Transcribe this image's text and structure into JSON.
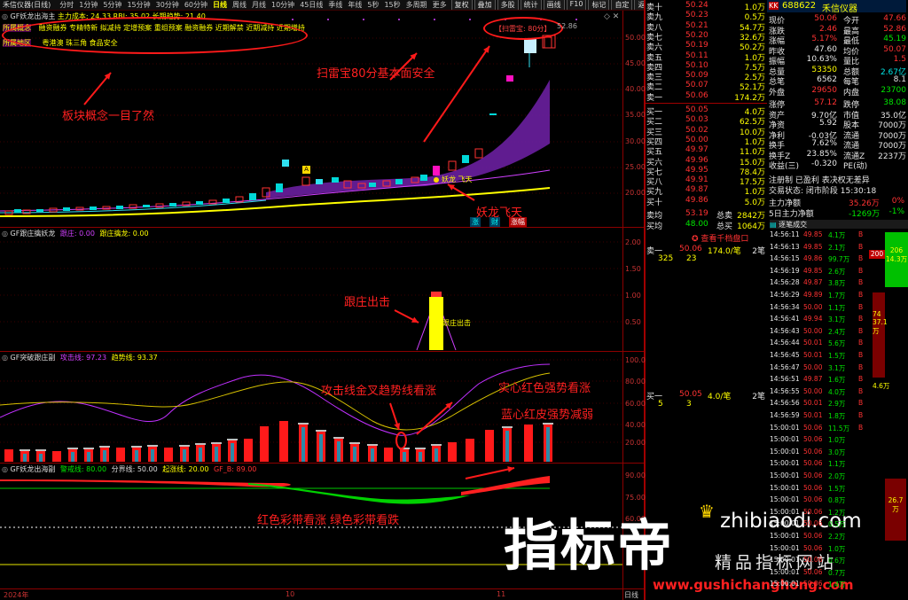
{
  "toolbar": {
    "app_title": "禾信仪器(日线)",
    "timeframes": [
      "分时",
      "1分钟",
      "5分钟",
      "15分钟",
      "30分钟",
      "60分钟",
      "日线",
      "周线",
      "月线",
      "10分钟",
      "45日线",
      "季线",
      "年线",
      "5秒",
      "15秒",
      "多周期",
      "更多"
    ],
    "active_timeframe": "日线",
    "buttons": [
      "复权",
      "叠加",
      "多股",
      "统计",
      "画线",
      "F10",
      "标记",
      "自定",
      "返回"
    ]
  },
  "main_panel": {
    "title_name": "GF妖龙出海主",
    "indicator_text": "主力成本: 24.33 RBI: 35.02 长期趋势: 21.40",
    "concept_label": "所属概念",
    "concepts": "融资融券 专精特新 拟减持 定增预案 重组预案 融资融券 近期解禁 近期减持 近期增持",
    "region_label": "所属地区",
    "region": "粤港澳 珠三角 食品安全",
    "saolei_text": "【扫雷宝: 80分】",
    "high_label": "52.86",
    "badge_a": "A",
    "yaolong_small": "妖龙 飞天",
    "bottom_tags": [
      "涨",
      "财",
      "涨幅"
    ],
    "y_ticks": [
      "50.00",
      "45.00",
      "40.00",
      "35.00",
      "30.00",
      "25.00",
      "20.00"
    ]
  },
  "sub1": {
    "title": "GF跟庄擒妖龙",
    "l1": "跟庄: 0.00",
    "l2": "跟庄擒龙: 0.00",
    "bar_label": "跟庄出击",
    "y_ticks": [
      "2.00",
      "1.50",
      "1.00",
      "0.50"
    ]
  },
  "sub2": {
    "title": "GF突破跟庄副",
    "l1": "攻击线: 97.23",
    "l2": "趋势线: 93.37",
    "y_ticks": [
      "100.0",
      "80.00",
      "60.00",
      "40.00",
      "20.00"
    ]
  },
  "sub3": {
    "title": "GF妖龙出海副",
    "l1": "警戒线: 80.00",
    "l2": "分界线: 50.00",
    "l3": "起涨线: 20.00",
    "l4": "GF_B: 89.00",
    "y_ticks": [
      "90.00",
      "75.00",
      "60.00"
    ]
  },
  "xaxis": {
    "labels": [
      "2024年",
      "10",
      "11"
    ],
    "right": "日线"
  },
  "annotations": {
    "a1": "板块概念一目了然",
    "a2": "扫雷宝80分基本面安全",
    "a3": "妖龙飞天",
    "a4": "跟庄出击",
    "a5": "攻击线金叉趋势线看涨",
    "a6": "实心红色强势看涨",
    "a7": "蓝心红皮强势减弱",
    "a8": "红色彩带看涨 绿色彩带看跌"
  },
  "watermark": {
    "main": "指标帝",
    "domain": "zhibiaodi.com",
    "line2": "精品指标网站",
    "url": "www.gushichanghong.com"
  },
  "stock": {
    "code": "688622",
    "name": "禾信仪器",
    "prefix": "KK"
  },
  "orderbook": {
    "asks": [
      {
        "label": "卖十",
        "price": "50.24",
        "vol": "1.0万"
      },
      {
        "label": "卖九",
        "price": "50.23",
        "vol": "0.5万"
      },
      {
        "label": "卖八",
        "price": "50.21",
        "vol": "54.7万"
      },
      {
        "label": "卖七",
        "price": "50.20",
        "vol": "32.6万"
      },
      {
        "label": "卖六",
        "price": "50.19",
        "vol": "50.2万"
      },
      {
        "label": "卖五",
        "price": "50.11",
        "vol": "1.0万"
      },
      {
        "label": "卖四",
        "price": "50.10",
        "vol": "7.5万"
      },
      {
        "label": "卖三",
        "price": "50.09",
        "vol": "2.5万"
      },
      {
        "label": "卖二",
        "price": "50.07",
        "vol": "52.1万"
      },
      {
        "label": "卖一",
        "price": "50.06",
        "vol": "174.2万"
      }
    ],
    "bids": [
      {
        "label": "买一",
        "price": "50.05",
        "vol": "4.0万"
      },
      {
        "label": "买二",
        "price": "50.03",
        "vol": "62.5万"
      },
      {
        "label": "买三",
        "price": "50.02",
        "vol": "10.0万"
      },
      {
        "label": "买四",
        "price": "50.00",
        "vol": "1.0万"
      },
      {
        "label": "买五",
        "price": "49.97",
        "vol": "11.0万"
      },
      {
        "label": "买六",
        "price": "49.96",
        "vol": "15.0万"
      },
      {
        "label": "买七",
        "price": "49.95",
        "vol": "78.4万"
      },
      {
        "label": "买八",
        "price": "49.91",
        "vol": "17.5万"
      },
      {
        "label": "买九",
        "price": "49.87",
        "vol": "1.0万"
      },
      {
        "label": "买十",
        "price": "49.86",
        "vol": "5.0万"
      }
    ],
    "avg_sell": {
      "label": "卖均",
      "price": "53.19",
      "tl": "总卖",
      "tv": "2842万"
    },
    "avg_buy": {
      "label": "买均",
      "price": "48.00",
      "tl": "总买",
      "tv": "1064万"
    },
    "l2_link": "查看千档盘口",
    "sell1_row": {
      "label": "卖一",
      "price": "50.06",
      "vol": "174.0/笔",
      "cnt": "2笔",
      "d1": "325",
      "d2": "23"
    },
    "buy1_row": {
      "label": "买一",
      "price": "50.05",
      "vol": "4.0/笔",
      "cnt": "2笔",
      "d1": "5",
      "d2": "3"
    }
  },
  "stats": [
    {
      "l": "现价",
      "v": "50.06",
      "l2": "今开",
      "v2": "47.66",
      "c1": "red",
      "c2": "red"
    },
    {
      "l": "涨跌",
      "v": "2.46",
      "l2": "最高",
      "v2": "52.86",
      "c1": "red",
      "c2": "red"
    },
    {
      "l": "涨幅",
      "v": "5.17%",
      "l2": "最低",
      "v2": "45.19",
      "c1": "red",
      "c2": "green"
    },
    {
      "l": "昨收",
      "v": "47.60",
      "l2": "均价",
      "v2": "50.07",
      "c1": "wht",
      "c2": "red"
    },
    {
      "l": "振幅",
      "v": "10.63%",
      "l2": "量比",
      "v2": "1.5",
      "c1": "wht",
      "c2": "red"
    },
    {
      "l": "总量",
      "v": "53350",
      "l2": "总额",
      "v2": "2.67亿",
      "c1": "yel",
      "c2": "cyan"
    },
    {
      "l": "总笔",
      "v": "6562",
      "l2": "每笔",
      "v2": "8.1",
      "c1": "wht",
      "c2": "wht"
    },
    {
      "l": "外盘",
      "v": "29650",
      "l2": "内盘",
      "v2": "23700",
      "c1": "red",
      "c2": "green"
    },
    {
      "l": "涨停",
      "v": "57.12",
      "l2": "跌停",
      "v2": "38.08",
      "c1": "red",
      "c2": "green"
    },
    {
      "l": "资产",
      "v": "9.70亿",
      "l2": "市值",
      "v2": "35.0亿",
      "c1": "wht",
      "c2": "wht"
    },
    {
      "l": "净资",
      "v": "5.92",
      "l2": "股本",
      "v2": "7000万",
      "c1": "wht",
      "c2": "wht"
    },
    {
      "l": "净利",
      "v": "-0.03亿",
      "l2": "流通",
      "v2": "7000万",
      "c1": "wht",
      "c2": "wht"
    },
    {
      "l": "换手",
      "v": "7.62%",
      "l2": "流通",
      "v2": "7000万",
      "c1": "wht",
      "c2": "wht"
    },
    {
      "l": "换手Z",
      "v": "23.85%",
      "l2": "流通Z",
      "v2": "2237万",
      "c1": "wht",
      "c2": "wht"
    },
    {
      "l": "收益(三)",
      "v": "-0.320",
      "l2": "PE(动)",
      "v2": "",
      "c1": "wht",
      "c2": "wht"
    }
  ],
  "info": {
    "line1": "注册制 已盈利 表决权无差异",
    "line2_label": "交易状态:",
    "line2_val": "闭市阶段 15:30:18"
  },
  "netflow": [
    {
      "l": "主力净额",
      "v": "35.26万",
      "p": "0%",
      "c": "red"
    },
    {
      "l": "5日主力净额",
      "v": "-1269万",
      "p": "-1%",
      "c": "green"
    }
  ],
  "trades_title": "逐笔成交",
  "trades": [
    [
      "14:56:11",
      "49.85",
      "4.1万",
      "B"
    ],
    [
      "14:56:13",
      "49.85",
      "2.1万",
      "B"
    ],
    [
      "14:56:15",
      "49.86",
      "99.7万",
      "B"
    ],
    [
      "14:56:19",
      "49.85",
      "2.6万",
      "B"
    ],
    [
      "14:56:28",
      "49.87",
      "3.8万",
      "B"
    ],
    [
      "14:56:29",
      "49.89",
      "1.7万",
      "B"
    ],
    [
      "14:56:34",
      "50.00",
      "1.1万",
      "B"
    ],
    [
      "14:56:41",
      "49.94",
      "3.1万",
      "B"
    ],
    [
      "14:56:43",
      "50.00",
      "2.4万",
      "B"
    ],
    [
      "14:56:44",
      "50.01",
      "5.6万",
      "B"
    ],
    [
      "14:56:45",
      "50.01",
      "1.5万",
      "B"
    ],
    [
      "14:56:47",
      "50.00",
      "3.1万",
      "B"
    ],
    [
      "14:56:51",
      "49.87",
      "1.6万",
      "B"
    ],
    [
      "14:56:55",
      "50.00",
      "4.0万",
      "B"
    ],
    [
      "14:56:56",
      "50.01",
      "2.9万",
      "B"
    ],
    [
      "14:56:59",
      "50.01",
      "1.8万",
      "B"
    ],
    [
      "15:00:01",
      "50.06",
      "11.5万",
      "B"
    ],
    [
      "15:00:01",
      "50.06",
      "1.0万",
      ""
    ],
    [
      "15:00:01",
      "50.06",
      "3.0万",
      ""
    ],
    [
      "15:00:01",
      "50.06",
      "1.1万",
      ""
    ],
    [
      "15:00:01",
      "50.06",
      "2.0万",
      ""
    ],
    [
      "15:00:01",
      "50.06",
      "1.5万",
      ""
    ],
    [
      "15:00:01",
      "50.06",
      "0.8万",
      ""
    ],
    [
      "15:00:01",
      "50.06",
      "1.2万",
      ""
    ],
    [
      "15:00:01",
      "50.06",
      "0.5万",
      ""
    ],
    [
      "15:00:01",
      "50.06",
      "2.2万",
      ""
    ],
    [
      "15:00:01",
      "50.06",
      "1.0万",
      ""
    ],
    [
      "15:00:01",
      "50.06",
      "0.6万",
      ""
    ],
    [
      "15:00:01",
      "50.06",
      "0.7万",
      ""
    ],
    [
      "15:00:01",
      "50.06",
      "1.4万",
      ""
    ]
  ],
  "side_numbers": {
    "n1": "200",
    "n2": "206",
    "n3": "14.3万",
    "n4": "74",
    "n5": "37.1万",
    "n6": "4.6万",
    "n7": "26.7万"
  },
  "colors": {
    "up": "#ff3232",
    "down": "#00e600",
    "grid": "#640000",
    "purple": "#7a2aa8",
    "yellow": "#ffff00",
    "cyan": "#30e0f0"
  }
}
